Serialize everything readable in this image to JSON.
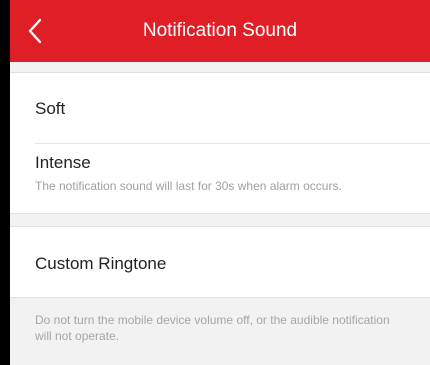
{
  "header": {
    "title": "Notification Sound",
    "back_icon": "chevron-left-icon",
    "background_color": "#e01e26"
  },
  "options": [
    {
      "label": "Soft",
      "description": ""
    },
    {
      "label": "Intense",
      "description": "The notification sound will last for 30s when alarm occurs."
    }
  ],
  "custom": {
    "label": "Custom Ringtone"
  },
  "footer": {
    "note": "Do not turn the mobile device volume off, or the audible notification will not operate."
  }
}
